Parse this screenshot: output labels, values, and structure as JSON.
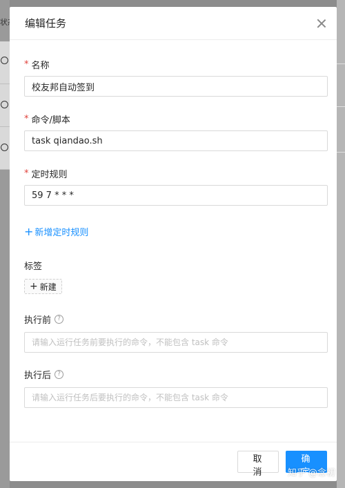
{
  "background": {
    "column_header_partial": "状态"
  },
  "modal": {
    "title": "编辑任务",
    "fields": {
      "name": {
        "label": "名称",
        "required": true,
        "value": "校友邦自动签到"
      },
      "command": {
        "label": "命令/脚本",
        "required": true,
        "value": "task qiandao.sh"
      },
      "schedule": {
        "label": "定时规则",
        "required": true,
        "value": "59 7 * * *"
      }
    },
    "add_schedule_link": "新增定时规则",
    "tags": {
      "label": "标签",
      "new_button": "新建"
    },
    "before": {
      "label": "执行前",
      "placeholder": "请输入运行任务前要执行的命令，不能包含 task 命令"
    },
    "after": {
      "label": "执行后",
      "placeholder": "请输入运行任务后要执行的命令，不能包含 task 命令"
    },
    "footer": {
      "cancel": "取 消",
      "ok": "确 定"
    }
  },
  "watermark": "知乎 @念初",
  "colors": {
    "primary": "#1890ff",
    "required": "#e0403a"
  },
  "icons": [
    "close-icon",
    "plus-icon",
    "help-icon",
    "clock-icon"
  ]
}
